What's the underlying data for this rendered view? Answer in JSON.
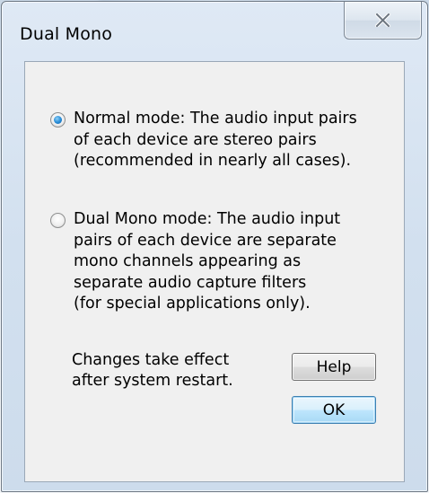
{
  "window": {
    "title": "Dual Mono",
    "close_icon": "close-icon"
  },
  "options": [
    {
      "selected": true,
      "lines": [
        "Normal mode:  The audio input pairs",
        "of each device are stereo pairs",
        "(recommended in nearly all cases)."
      ]
    },
    {
      "selected": false,
      "lines": [
        "Dual Mono mode:  The audio input",
        "pairs of each device are separate",
        "mono channels appearing as",
        "separate audio capture filters",
        "(for special applications only)."
      ]
    }
  ],
  "note": {
    "lines": [
      "Changes take effect",
      "after system restart."
    ]
  },
  "buttons": {
    "help_label": "Help",
    "ok_label": "OK"
  },
  "colors": {
    "accent": "#2b8fd8",
    "dialog_face": "#f0f0f0",
    "frame": "#d2e0ef"
  }
}
